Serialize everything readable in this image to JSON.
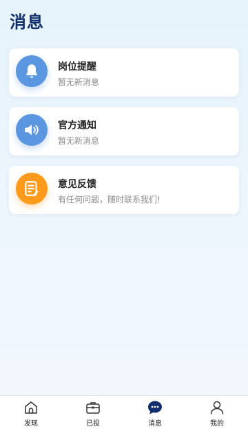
{
  "header": {
    "title": "消息"
  },
  "cards": [
    {
      "title": "岗位提醒",
      "subtitle": "暂无新消息",
      "icon": "bell-icon",
      "color": "#5b96e0"
    },
    {
      "title": "官方通知",
      "subtitle": "暂无新消息",
      "icon": "speaker-icon",
      "color": "#5b96e0"
    },
    {
      "title": "意见反馈",
      "subtitle": "有任何问题，随时联系我们!",
      "icon": "feedback-note-icon",
      "color": "#ff9a1a"
    }
  ],
  "tabbar": {
    "items": [
      {
        "label": "发现",
        "icon": "home-icon",
        "active": false
      },
      {
        "label": "已投",
        "icon": "briefcase-icon",
        "active": false
      },
      {
        "label": "消息",
        "icon": "chat-bubble-icon",
        "active": true
      },
      {
        "label": "我的",
        "icon": "user-icon",
        "active": false
      }
    ]
  }
}
